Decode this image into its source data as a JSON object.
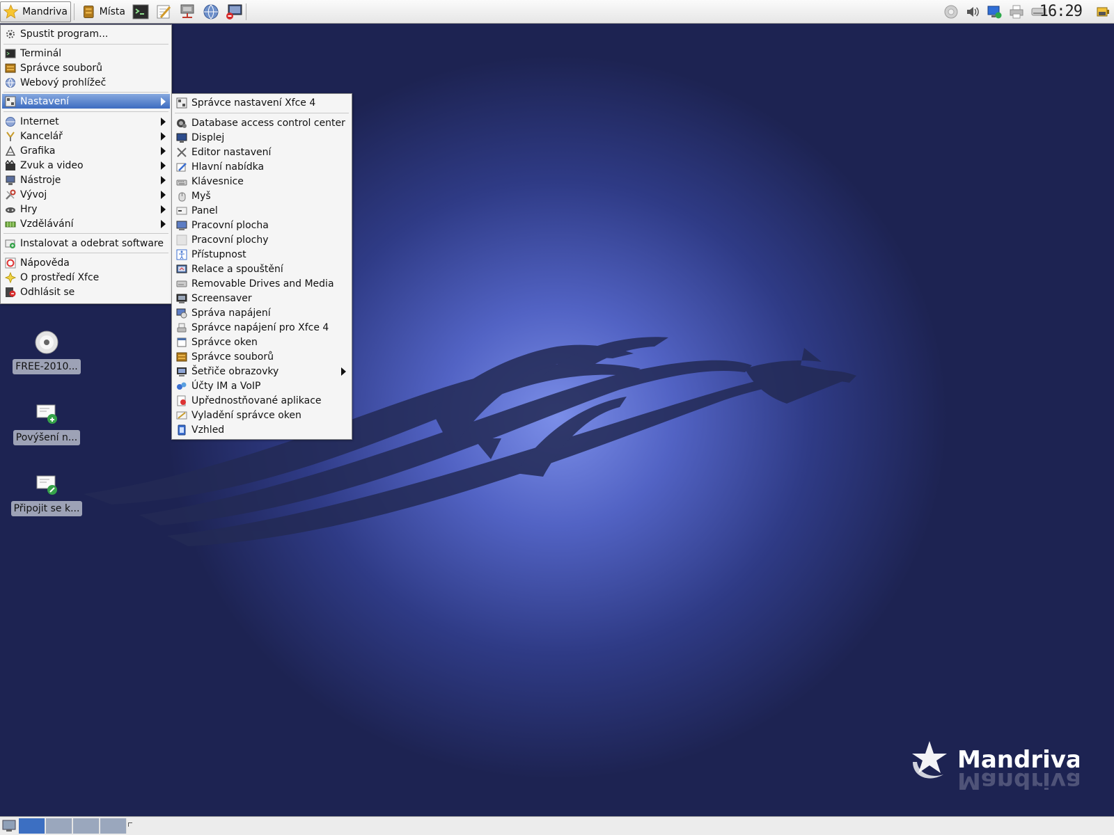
{
  "top_panel": {
    "menu_button_label": "Mandriva",
    "places_label": "Místa",
    "launchers": [
      "terminal-icon",
      "text-editor-icon",
      "network-icon",
      "web-browser-icon",
      "remote-desktop-icon"
    ],
    "clock": "16:29",
    "tray_icons": [
      "mixer-icon",
      "volume-icon",
      "network-status-icon",
      "printer-icon",
      "drive-icon",
      "battery-icon"
    ]
  },
  "main_menu": {
    "run_program": "Spustit program...",
    "terminal": "Terminál",
    "file_manager": "Správce souborů",
    "web_browser": "Webový prohlížeč",
    "settings": "Nastavení",
    "internet": "Internet",
    "office": "Kancelář",
    "graphics": "Grafika",
    "sound_video": "Zvuk a video",
    "tools": "Nástroje",
    "development": "Vývoj",
    "games": "Hry",
    "education": "Vzdělávání",
    "install_software": "Instalovat a odebrat software",
    "help": "Nápověda",
    "about_xfce": "O prostředí Xfce",
    "logout": "Odhlásit se"
  },
  "settings_submenu": {
    "items": [
      "Správce nastavení Xfce 4",
      "Database access control center",
      "Displej",
      "Editor nastavení",
      "Hlavní nabídka",
      "Klávesnice",
      "Myš",
      "Panel",
      "Pracovní plocha",
      "Pracovní plochy",
      "Přístupnost",
      "Relace a spouštění",
      "Removable Drives and Media",
      "Screensaver",
      "Správa napájení",
      "Správce napájení pro Xfce 4",
      "Správce oken",
      "Správce souborů",
      "Šetřiče obrazovky",
      "Účty IM a VoIP",
      "Upřednostňované aplikace",
      "Vyladění správce oken",
      "Vzhled"
    ]
  },
  "desktop_icons": [
    {
      "label": "FREE-2010...",
      "icon": "cdrom-icon"
    },
    {
      "label": "Povýšení n...",
      "icon": "upgrade-icon"
    },
    {
      "label": "Připojit se k...",
      "icon": "connect-icon"
    }
  ],
  "wallpaper": {
    "logo_text": "Mandriva"
  },
  "bottom_panel": {
    "workspaces": 4,
    "current_workspace": 1
  }
}
